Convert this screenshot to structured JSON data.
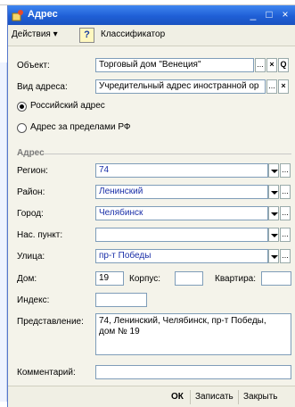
{
  "window": {
    "title": "Адрес",
    "controls": [
      "_",
      "□",
      "×"
    ]
  },
  "toolbar": {
    "actions": "Действия ▾",
    "help": "?",
    "classifier": "Классификатор"
  },
  "form": {
    "object_label": "Объект:",
    "object_value": "Торговый дом \"Венеция\"",
    "addr_type_label": "Вид адреса:",
    "addr_type_value": "Учредительный адрес иностранной ор",
    "radio_russia": "Российский адрес",
    "radio_abroad": "Адрес за пределами РФ",
    "section": "Адрес",
    "region_label": "Регион:",
    "region_value": "74",
    "district_label": "Район:",
    "district_value": "Ленинский",
    "city_label": "Город:",
    "city_value": "Челябинск",
    "locality_label": "Нас. пункт:",
    "locality_value": "",
    "street_label": "Улица:",
    "street_value": "пр-т Победы",
    "house_label": "Дом:",
    "house_value": "19",
    "building_label": "Корпус:",
    "building_value": "",
    "flat_label": "Квартира:",
    "flat_value": "",
    "index_label": "Индекс:",
    "index_value": "",
    "repr_label": "Представление:",
    "repr_line1": "74, Ленинский, Челябинск, пр-т Победы,",
    "repr_line2": "дом № 19",
    "comment_label": "Комментарий:",
    "comment_value": ""
  },
  "buttons": {
    "ok": "ОК",
    "save": "Записать",
    "close": "Закрыть"
  },
  "glyphs": {
    "ellipsis": "...",
    "clear": "×",
    "search": "Q"
  }
}
